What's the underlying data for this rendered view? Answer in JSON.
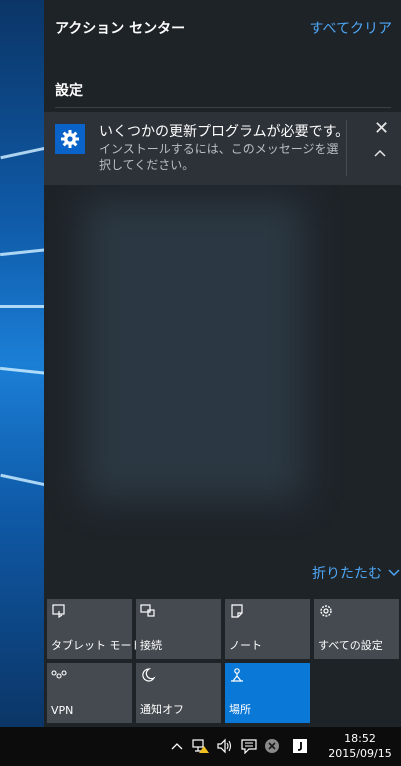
{
  "header": {
    "title": "アクション センター",
    "clear_all": "すべてクリア"
  },
  "group": {
    "title": "設定"
  },
  "notification": {
    "title": "いくつかの更新プログラムが必要です。",
    "body": "インストールするには、このメッセージを選択してください。",
    "app_icon": "gear-icon",
    "close_glyph": "✕"
  },
  "collapse": {
    "label": "折りたたむ"
  },
  "quick_actions": [
    {
      "label": "タブレット モード",
      "icon": "tablet-mode-icon",
      "active": false
    },
    {
      "label": "接続",
      "icon": "connect-icon",
      "active": false
    },
    {
      "label": "ノート",
      "icon": "note-icon",
      "active": false
    },
    {
      "label": "すべての設定",
      "icon": "gear-icon",
      "active": false
    },
    {
      "label": "VPN",
      "icon": "vpn-icon",
      "active": false
    },
    {
      "label": "通知オフ",
      "icon": "moon-icon",
      "active": false
    },
    {
      "label": "場所",
      "icon": "location-icon",
      "active": true
    }
  ],
  "taskbar": {
    "time": "18:52",
    "date": "2015/09/15"
  },
  "colors": {
    "accent": "#0a78d7",
    "link": "#4ea6f5",
    "panel": "#1e2328",
    "tile": "#444a50"
  }
}
